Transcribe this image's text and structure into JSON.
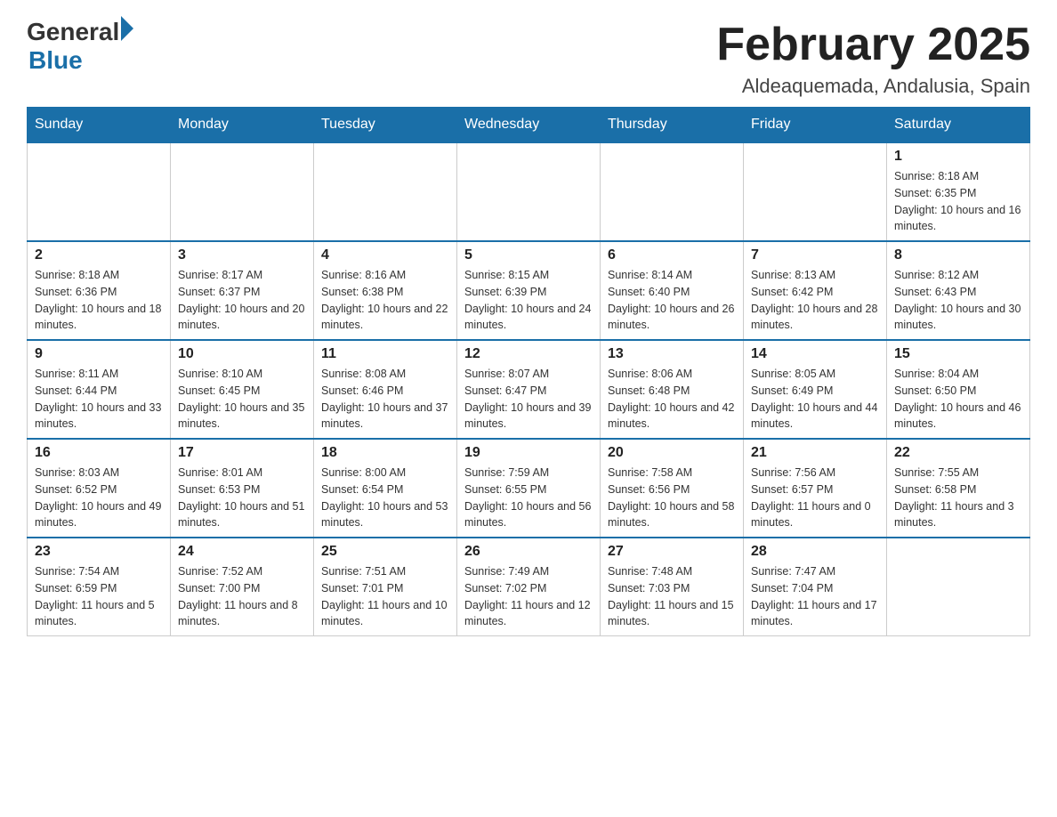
{
  "header": {
    "logo_general": "General",
    "logo_blue": "Blue",
    "month_title": "February 2025",
    "location": "Aldeaquemada, Andalusia, Spain"
  },
  "weekdays": [
    "Sunday",
    "Monday",
    "Tuesday",
    "Wednesday",
    "Thursday",
    "Friday",
    "Saturday"
  ],
  "weeks": [
    [
      {
        "day": "",
        "info": ""
      },
      {
        "day": "",
        "info": ""
      },
      {
        "day": "",
        "info": ""
      },
      {
        "day": "",
        "info": ""
      },
      {
        "day": "",
        "info": ""
      },
      {
        "day": "",
        "info": ""
      },
      {
        "day": "1",
        "info": "Sunrise: 8:18 AM\nSunset: 6:35 PM\nDaylight: 10 hours and 16 minutes."
      }
    ],
    [
      {
        "day": "2",
        "info": "Sunrise: 8:18 AM\nSunset: 6:36 PM\nDaylight: 10 hours and 18 minutes."
      },
      {
        "day": "3",
        "info": "Sunrise: 8:17 AM\nSunset: 6:37 PM\nDaylight: 10 hours and 20 minutes."
      },
      {
        "day": "4",
        "info": "Sunrise: 8:16 AM\nSunset: 6:38 PM\nDaylight: 10 hours and 22 minutes."
      },
      {
        "day": "5",
        "info": "Sunrise: 8:15 AM\nSunset: 6:39 PM\nDaylight: 10 hours and 24 minutes."
      },
      {
        "day": "6",
        "info": "Sunrise: 8:14 AM\nSunset: 6:40 PM\nDaylight: 10 hours and 26 minutes."
      },
      {
        "day": "7",
        "info": "Sunrise: 8:13 AM\nSunset: 6:42 PM\nDaylight: 10 hours and 28 minutes."
      },
      {
        "day": "8",
        "info": "Sunrise: 8:12 AM\nSunset: 6:43 PM\nDaylight: 10 hours and 30 minutes."
      }
    ],
    [
      {
        "day": "9",
        "info": "Sunrise: 8:11 AM\nSunset: 6:44 PM\nDaylight: 10 hours and 33 minutes."
      },
      {
        "day": "10",
        "info": "Sunrise: 8:10 AM\nSunset: 6:45 PM\nDaylight: 10 hours and 35 minutes."
      },
      {
        "day": "11",
        "info": "Sunrise: 8:08 AM\nSunset: 6:46 PM\nDaylight: 10 hours and 37 minutes."
      },
      {
        "day": "12",
        "info": "Sunrise: 8:07 AM\nSunset: 6:47 PM\nDaylight: 10 hours and 39 minutes."
      },
      {
        "day": "13",
        "info": "Sunrise: 8:06 AM\nSunset: 6:48 PM\nDaylight: 10 hours and 42 minutes."
      },
      {
        "day": "14",
        "info": "Sunrise: 8:05 AM\nSunset: 6:49 PM\nDaylight: 10 hours and 44 minutes."
      },
      {
        "day": "15",
        "info": "Sunrise: 8:04 AM\nSunset: 6:50 PM\nDaylight: 10 hours and 46 minutes."
      }
    ],
    [
      {
        "day": "16",
        "info": "Sunrise: 8:03 AM\nSunset: 6:52 PM\nDaylight: 10 hours and 49 minutes."
      },
      {
        "day": "17",
        "info": "Sunrise: 8:01 AM\nSunset: 6:53 PM\nDaylight: 10 hours and 51 minutes."
      },
      {
        "day": "18",
        "info": "Sunrise: 8:00 AM\nSunset: 6:54 PM\nDaylight: 10 hours and 53 minutes."
      },
      {
        "day": "19",
        "info": "Sunrise: 7:59 AM\nSunset: 6:55 PM\nDaylight: 10 hours and 56 minutes."
      },
      {
        "day": "20",
        "info": "Sunrise: 7:58 AM\nSunset: 6:56 PM\nDaylight: 10 hours and 58 minutes."
      },
      {
        "day": "21",
        "info": "Sunrise: 7:56 AM\nSunset: 6:57 PM\nDaylight: 11 hours and 0 minutes."
      },
      {
        "day": "22",
        "info": "Sunrise: 7:55 AM\nSunset: 6:58 PM\nDaylight: 11 hours and 3 minutes."
      }
    ],
    [
      {
        "day": "23",
        "info": "Sunrise: 7:54 AM\nSunset: 6:59 PM\nDaylight: 11 hours and 5 minutes."
      },
      {
        "day": "24",
        "info": "Sunrise: 7:52 AM\nSunset: 7:00 PM\nDaylight: 11 hours and 8 minutes."
      },
      {
        "day": "25",
        "info": "Sunrise: 7:51 AM\nSunset: 7:01 PM\nDaylight: 11 hours and 10 minutes."
      },
      {
        "day": "26",
        "info": "Sunrise: 7:49 AM\nSunset: 7:02 PM\nDaylight: 11 hours and 12 minutes."
      },
      {
        "day": "27",
        "info": "Sunrise: 7:48 AM\nSunset: 7:03 PM\nDaylight: 11 hours and 15 minutes."
      },
      {
        "day": "28",
        "info": "Sunrise: 7:47 AM\nSunset: 7:04 PM\nDaylight: 11 hours and 17 minutes."
      },
      {
        "day": "",
        "info": ""
      }
    ]
  ]
}
